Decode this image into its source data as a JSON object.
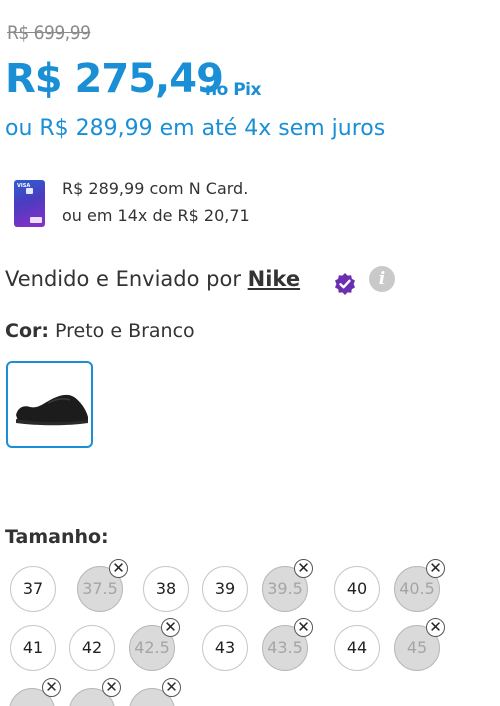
{
  "price": {
    "old": "R$ 699,99",
    "pix": "R$ 275,49",
    "pix_suffix": "no Pix",
    "installments": "ou R$ 289,99 em até 4x sem juros"
  },
  "ncard": {
    "line1": "R$ 289,99 com N Card.",
    "line2": "ou em 14x de R$ 20,71"
  },
  "seller": {
    "prefix": "Vendido e Enviado por ",
    "name": "Nike"
  },
  "color": {
    "label": "Cor:",
    "value": "Preto e Branco"
  },
  "sizes": {
    "label": "Tamanho:",
    "row1": [
      {
        "size": "37",
        "available": true
      },
      {
        "size": "37.5",
        "available": false
      },
      {
        "size": "38",
        "available": true
      },
      {
        "size": "39",
        "available": true
      },
      {
        "size": "39.5",
        "available": false
      },
      {
        "size": "40",
        "available": true
      },
      {
        "size": "40.5",
        "available": false
      }
    ],
    "row2": [
      {
        "size": "41",
        "available": true
      },
      {
        "size": "42",
        "available": true
      },
      {
        "size": "42.5",
        "available": false
      },
      {
        "size": "43",
        "available": true
      },
      {
        "size": "43.5",
        "available": false
      },
      {
        "size": "44",
        "available": true
      },
      {
        "size": "45",
        "available": false
      }
    ]
  },
  "colors": {
    "accent": "#1a8fd6",
    "verified": "#6a2fb0"
  }
}
